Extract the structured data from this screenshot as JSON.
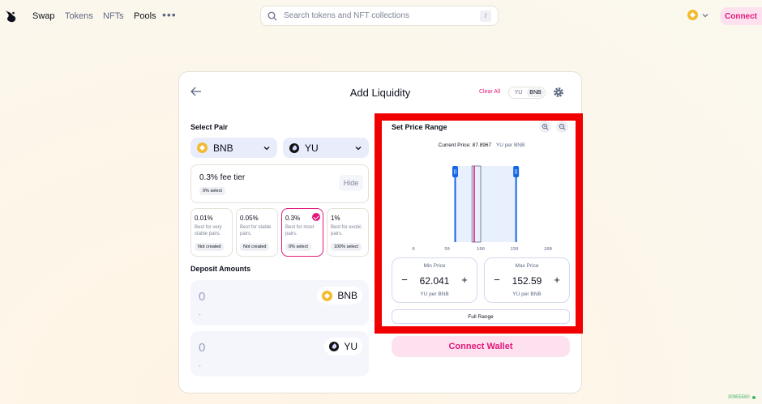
{
  "nav": {
    "links": [
      "Swap",
      "Tokens",
      "NFTs",
      "Pools"
    ],
    "more": "•••",
    "search_placeholder": "Search tokens and NFT collections",
    "search_shortcut": "/",
    "connect_label": "Connect"
  },
  "card": {
    "title": "Add Liquidity",
    "clear_all": "Clear All",
    "toggle": [
      "YU",
      "BNB"
    ],
    "select_pair_label": "Select Pair",
    "token_a": "BNB",
    "token_b": "YU",
    "fee_tier": {
      "title": "0.3% fee tier",
      "select_pill": "0% select",
      "hide_label": "Hide"
    },
    "fee_options": [
      {
        "pct": "0.01%",
        "desc": "Best for very stable pairs.",
        "pill": "Not created"
      },
      {
        "pct": "0.05%",
        "desc": "Best for stable pairs.",
        "pill": "Not created"
      },
      {
        "pct": "0.3%",
        "desc": "Best for most pairs.",
        "pill": "0% select",
        "selected": true
      },
      {
        "pct": "1%",
        "desc": "Best for exotic pairs.",
        "pill": "100% select"
      }
    ],
    "deposit_label": "Deposit Amounts",
    "deposits": [
      {
        "value": "0",
        "sub": "-",
        "token": "BNB"
      },
      {
        "value": "0",
        "sub": "-",
        "token": "YU"
      }
    ],
    "price_range": {
      "title": "Set Price Range",
      "current_price_label": "Current Price:",
      "current_price": "87.8967",
      "current_price_unit": "YU per BNB",
      "axis_ticks": [
        "0",
        "50",
        "100",
        "150",
        "200"
      ],
      "min_price": {
        "label": "Min Price",
        "value": "62.041",
        "unit": "YU per BNB"
      },
      "max_price": {
        "label": "Max Price",
        "value": "152.59",
        "unit": "YU per BNB"
      },
      "full_range_label": "Full Range"
    },
    "connect_wallet_label": "Connect Wallet"
  },
  "chart_data": {
    "type": "area",
    "x_ticks": [
      0,
      50,
      100,
      150,
      200
    ],
    "xlim": [
      0,
      200
    ],
    "current_price": 87.8967,
    "range_min": 62.041,
    "range_max": 152.59,
    "liquidity_bar_x": [
      87,
      100
    ]
  },
  "footer": {
    "block_number": "30955560"
  },
  "colors": {
    "accent": "#e2197b",
    "range_blue": "#1565e6",
    "range_fill": "#e8f0fd"
  }
}
